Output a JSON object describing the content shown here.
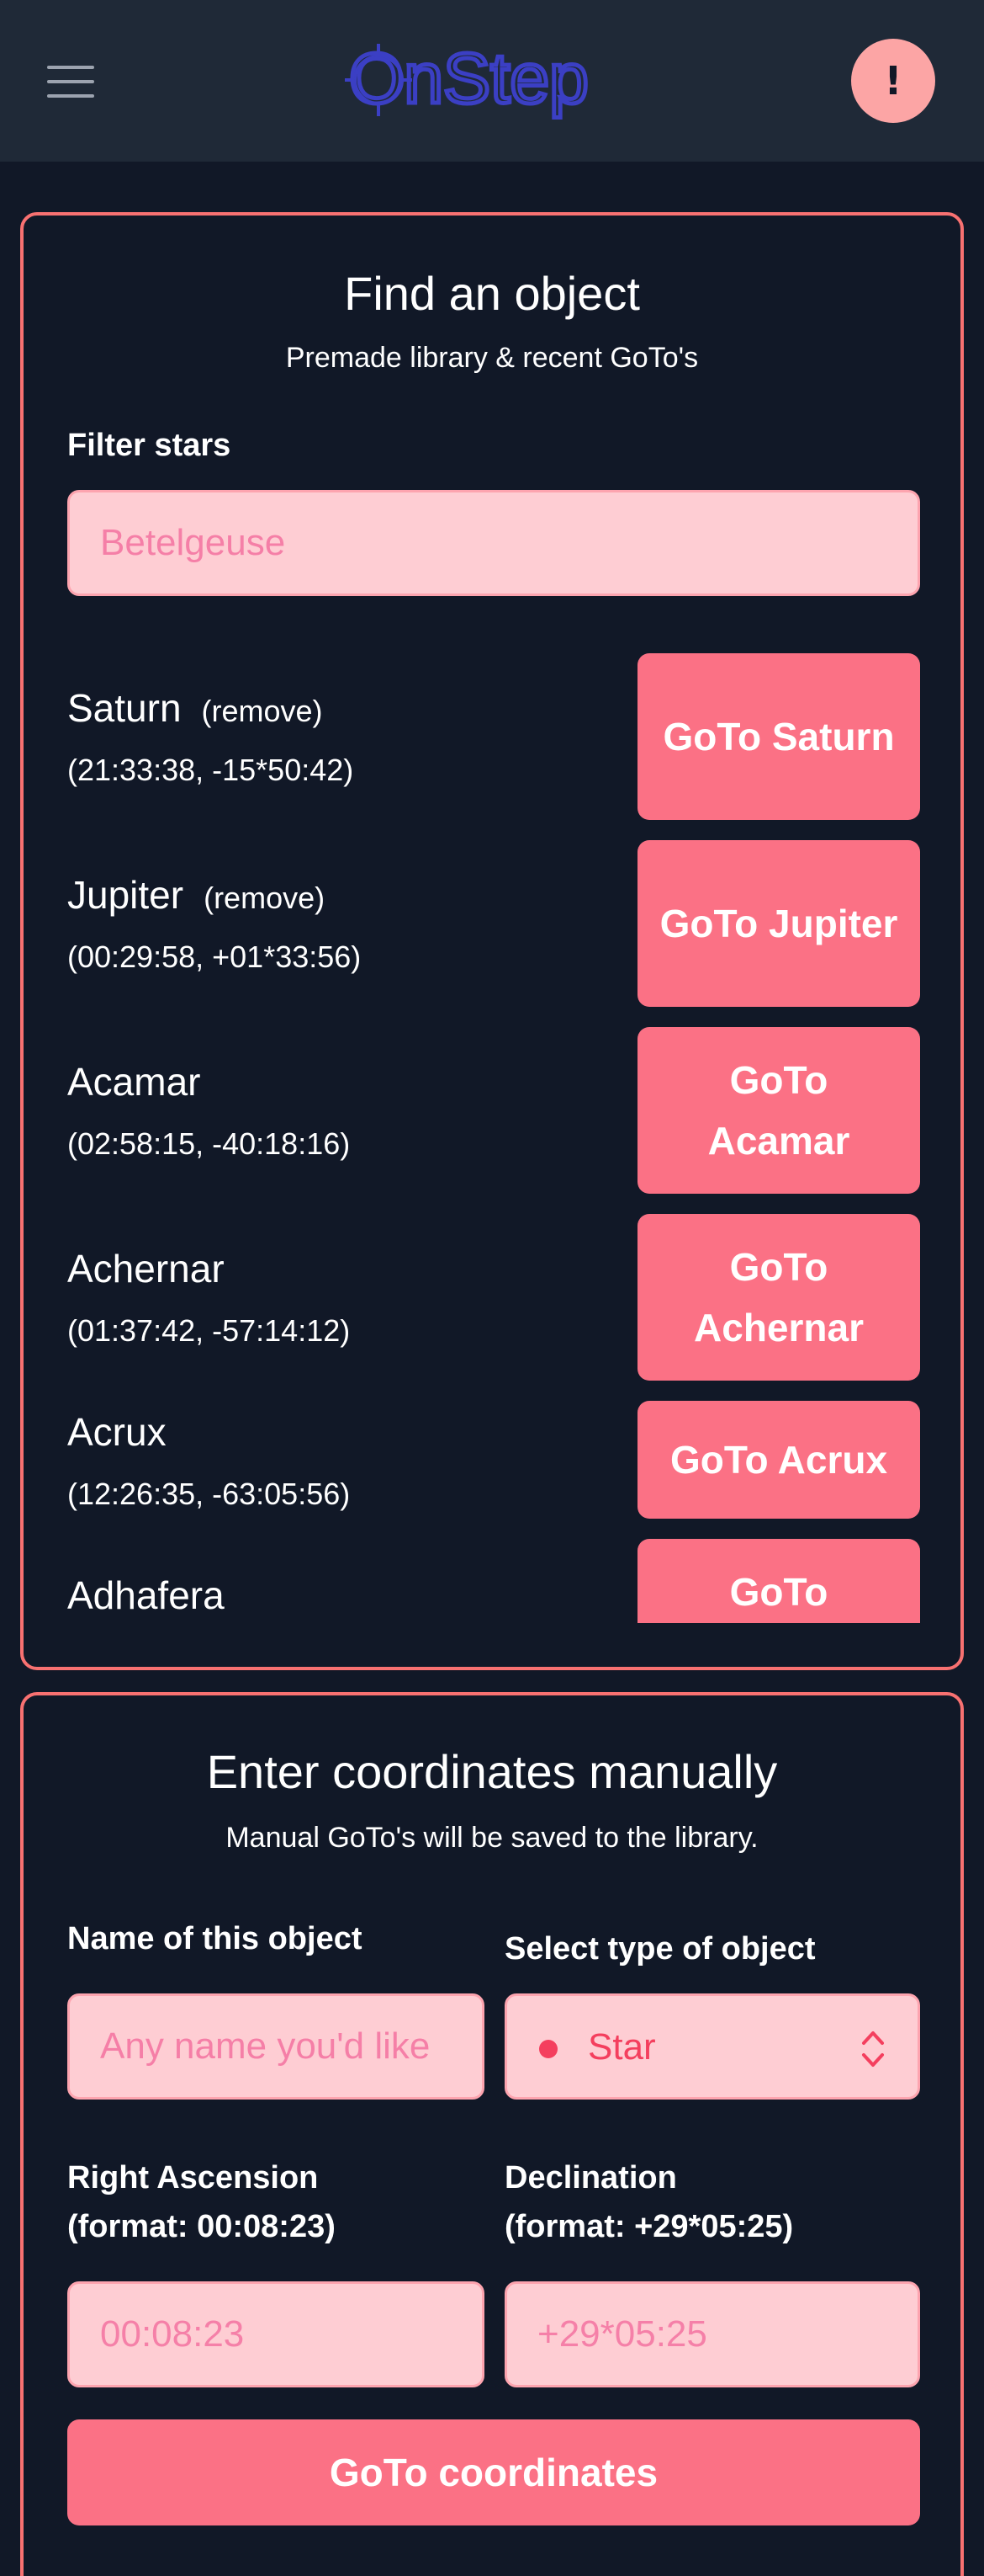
{
  "header": {
    "logo_text": "OnStep",
    "alert_symbol": "!"
  },
  "find": {
    "title": "Find an object",
    "subtitle": "Premade library & recent GoTo's",
    "filter_label": "Filter stars",
    "filter_placeholder": "Betelgeuse",
    "remove_label": "(remove)",
    "items": [
      {
        "name": "Saturn",
        "coords": "(21:33:38, -15*50:42)",
        "button": "GoTo Saturn",
        "removable": true
      },
      {
        "name": "Jupiter",
        "coords": "(00:29:58, +01*33:56)",
        "button": "GoTo Jupiter",
        "removable": true
      },
      {
        "name": "Acamar",
        "coords": "(02:58:15, -40:18:16)",
        "button": "GoTo Acamar",
        "removable": false
      },
      {
        "name": "Achernar",
        "coords": "(01:37:42, -57:14:12)",
        "button": "GoTo Achernar",
        "removable": false
      },
      {
        "name": "Acrux",
        "coords": "(12:26:35, -63:05:56)",
        "button": "GoTo Acrux",
        "removable": false
      },
      {
        "name": "Adhafera",
        "coords": "",
        "button": "GoTo Adhafera",
        "removable": false
      }
    ]
  },
  "manual": {
    "title": "Enter coordinates manually",
    "subtitle": "Manual GoTo's will be saved to the library.",
    "name_label": "Name of this object",
    "name_placeholder": "Any name you'd like",
    "type_label": "Select type of object",
    "type_value": "Star",
    "ra_label_line1": "Right Ascension",
    "ra_label_line2": "(format: 00:08:23)",
    "ra_placeholder": "00:08:23",
    "dec_label_line1": "Declination",
    "dec_label_line2": "(format: +29*05:25)",
    "dec_placeholder": "+29*05:25",
    "submit_label": "GoTo coordinates"
  },
  "colors": {
    "accent": "#fb7185",
    "border": "#f87171",
    "input_bg": "#fecdd3",
    "page_bg": "#111827",
    "header_bg": "#1f2937"
  },
  "icons": [
    "menu-icon",
    "onstep-logo",
    "alert-icon",
    "star-dot-icon",
    "chevron-updown-icon"
  ]
}
